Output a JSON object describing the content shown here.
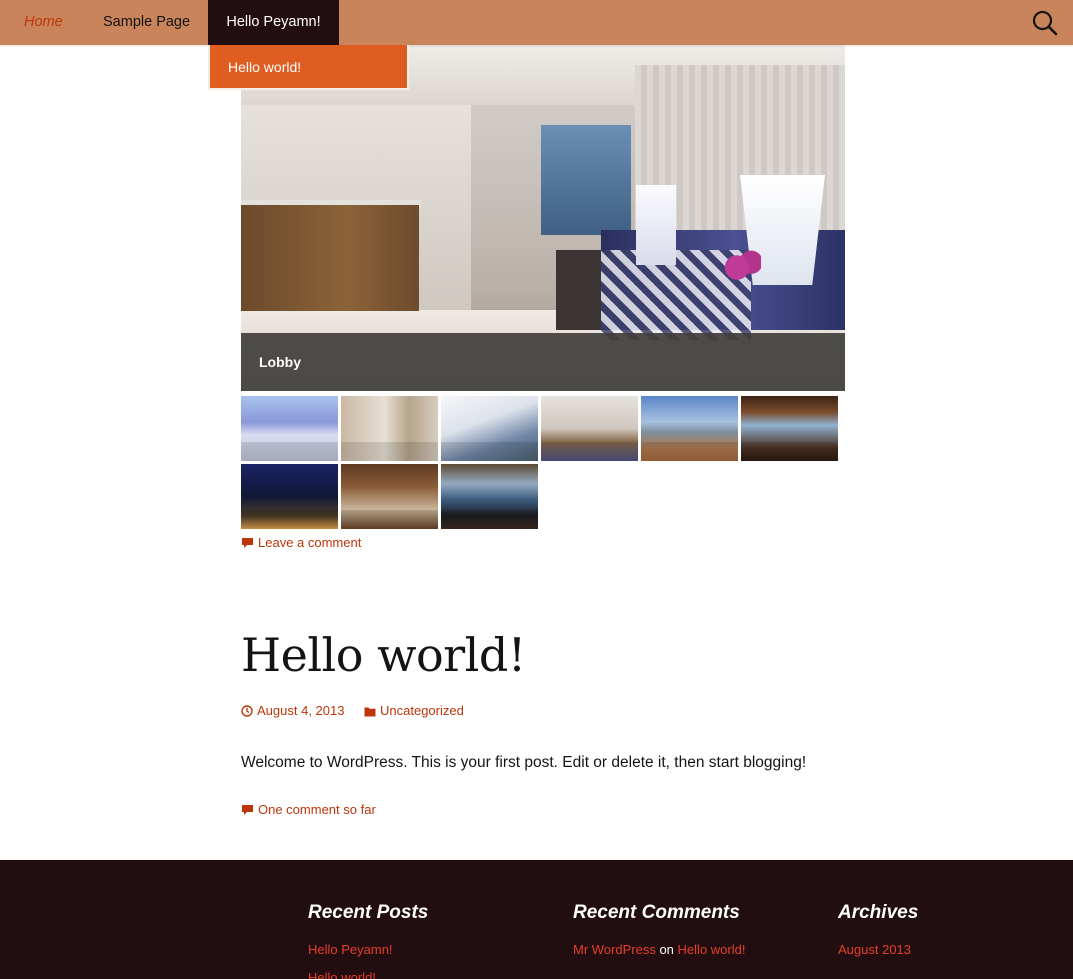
{
  "nav": {
    "home": "Home",
    "sample_page": "Sample Page",
    "hello_peyamn": "Hello Peyamn!",
    "dropdown_item": "Hello world!",
    "search_icon": "search-icon",
    "bar_color": "#c9845c",
    "active_color": "#220e10",
    "dropdown_color": "#e05d22"
  },
  "gallery": {
    "caption": "Lobby",
    "thumbnails": [
      "spa-bathroom",
      "hotel-room",
      "white-building",
      "lobby",
      "sea-terrace",
      "wood-veranda",
      "night-city",
      "lounge-interior",
      "dining-terrace"
    ]
  },
  "post": {
    "leave_comment": "Leave a comment",
    "title": "Hello world!",
    "date": "August 4, 2013",
    "category": "Uncategorized",
    "body": "Welcome to WordPress. This is your first post. Edit or delete it, then start blogging!",
    "comments_link": "One comment so far",
    "link_color": "#bc360a"
  },
  "footer": {
    "recent_posts": {
      "title": "Recent Posts",
      "items": [
        "Hello Peyamn!",
        "Hello world!"
      ]
    },
    "recent_comments": {
      "title": "Recent Comments",
      "author": "Mr WordPress",
      "on": "on",
      "post": "Hello world!"
    },
    "archives": {
      "title": "Archives",
      "items": [
        "August 2013"
      ]
    },
    "background_color": "#220e10"
  }
}
